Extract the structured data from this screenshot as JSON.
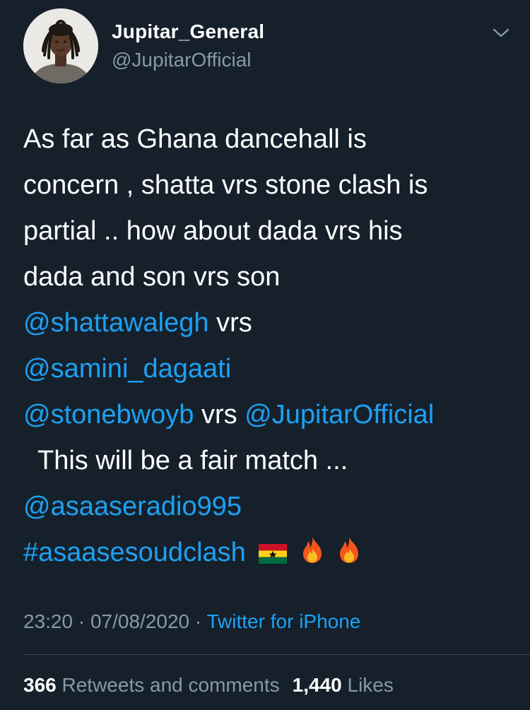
{
  "user": {
    "display_name": "Jupitar_General",
    "handle": "@JupitarOfficial",
    "avatar_icon": "avatar-photo-icon"
  },
  "tweet": {
    "line1": "As far as Ghana dancehall is",
    "line2": "concern , shatta vrs stone clash is",
    "line3": "partial .. how about dada vrs his",
    "line4": "dada and son vrs son",
    "mention1": "@shattawalegh",
    "vrs1": " vrs",
    "mention2": "@samini_dagaati",
    "mention3": "@stonebwoyb",
    "vrs2": " vrs ",
    "mention4": "@JupitarOfficial",
    "line8": "This will be a fair match ...",
    "mention5": "@asaaseradio995",
    "hashtag": "#asaasesoudclash",
    "emojis": [
      "ghana-flag-icon",
      "fire-icon",
      "fire-icon"
    ]
  },
  "meta": {
    "time": "23:20",
    "sep1": " · ",
    "date": "07/08/2020",
    "sep2": " · ",
    "source": "Twitter for iPhone"
  },
  "stats": {
    "retweets_count": "366",
    "retweets_label": "Retweets and comments",
    "likes_count": "1,440",
    "likes_label": "Likes"
  },
  "colors": {
    "background": "#15202b",
    "link": "#1da1f2",
    "secondary_text": "#8899a6",
    "divider": "#38444d"
  }
}
